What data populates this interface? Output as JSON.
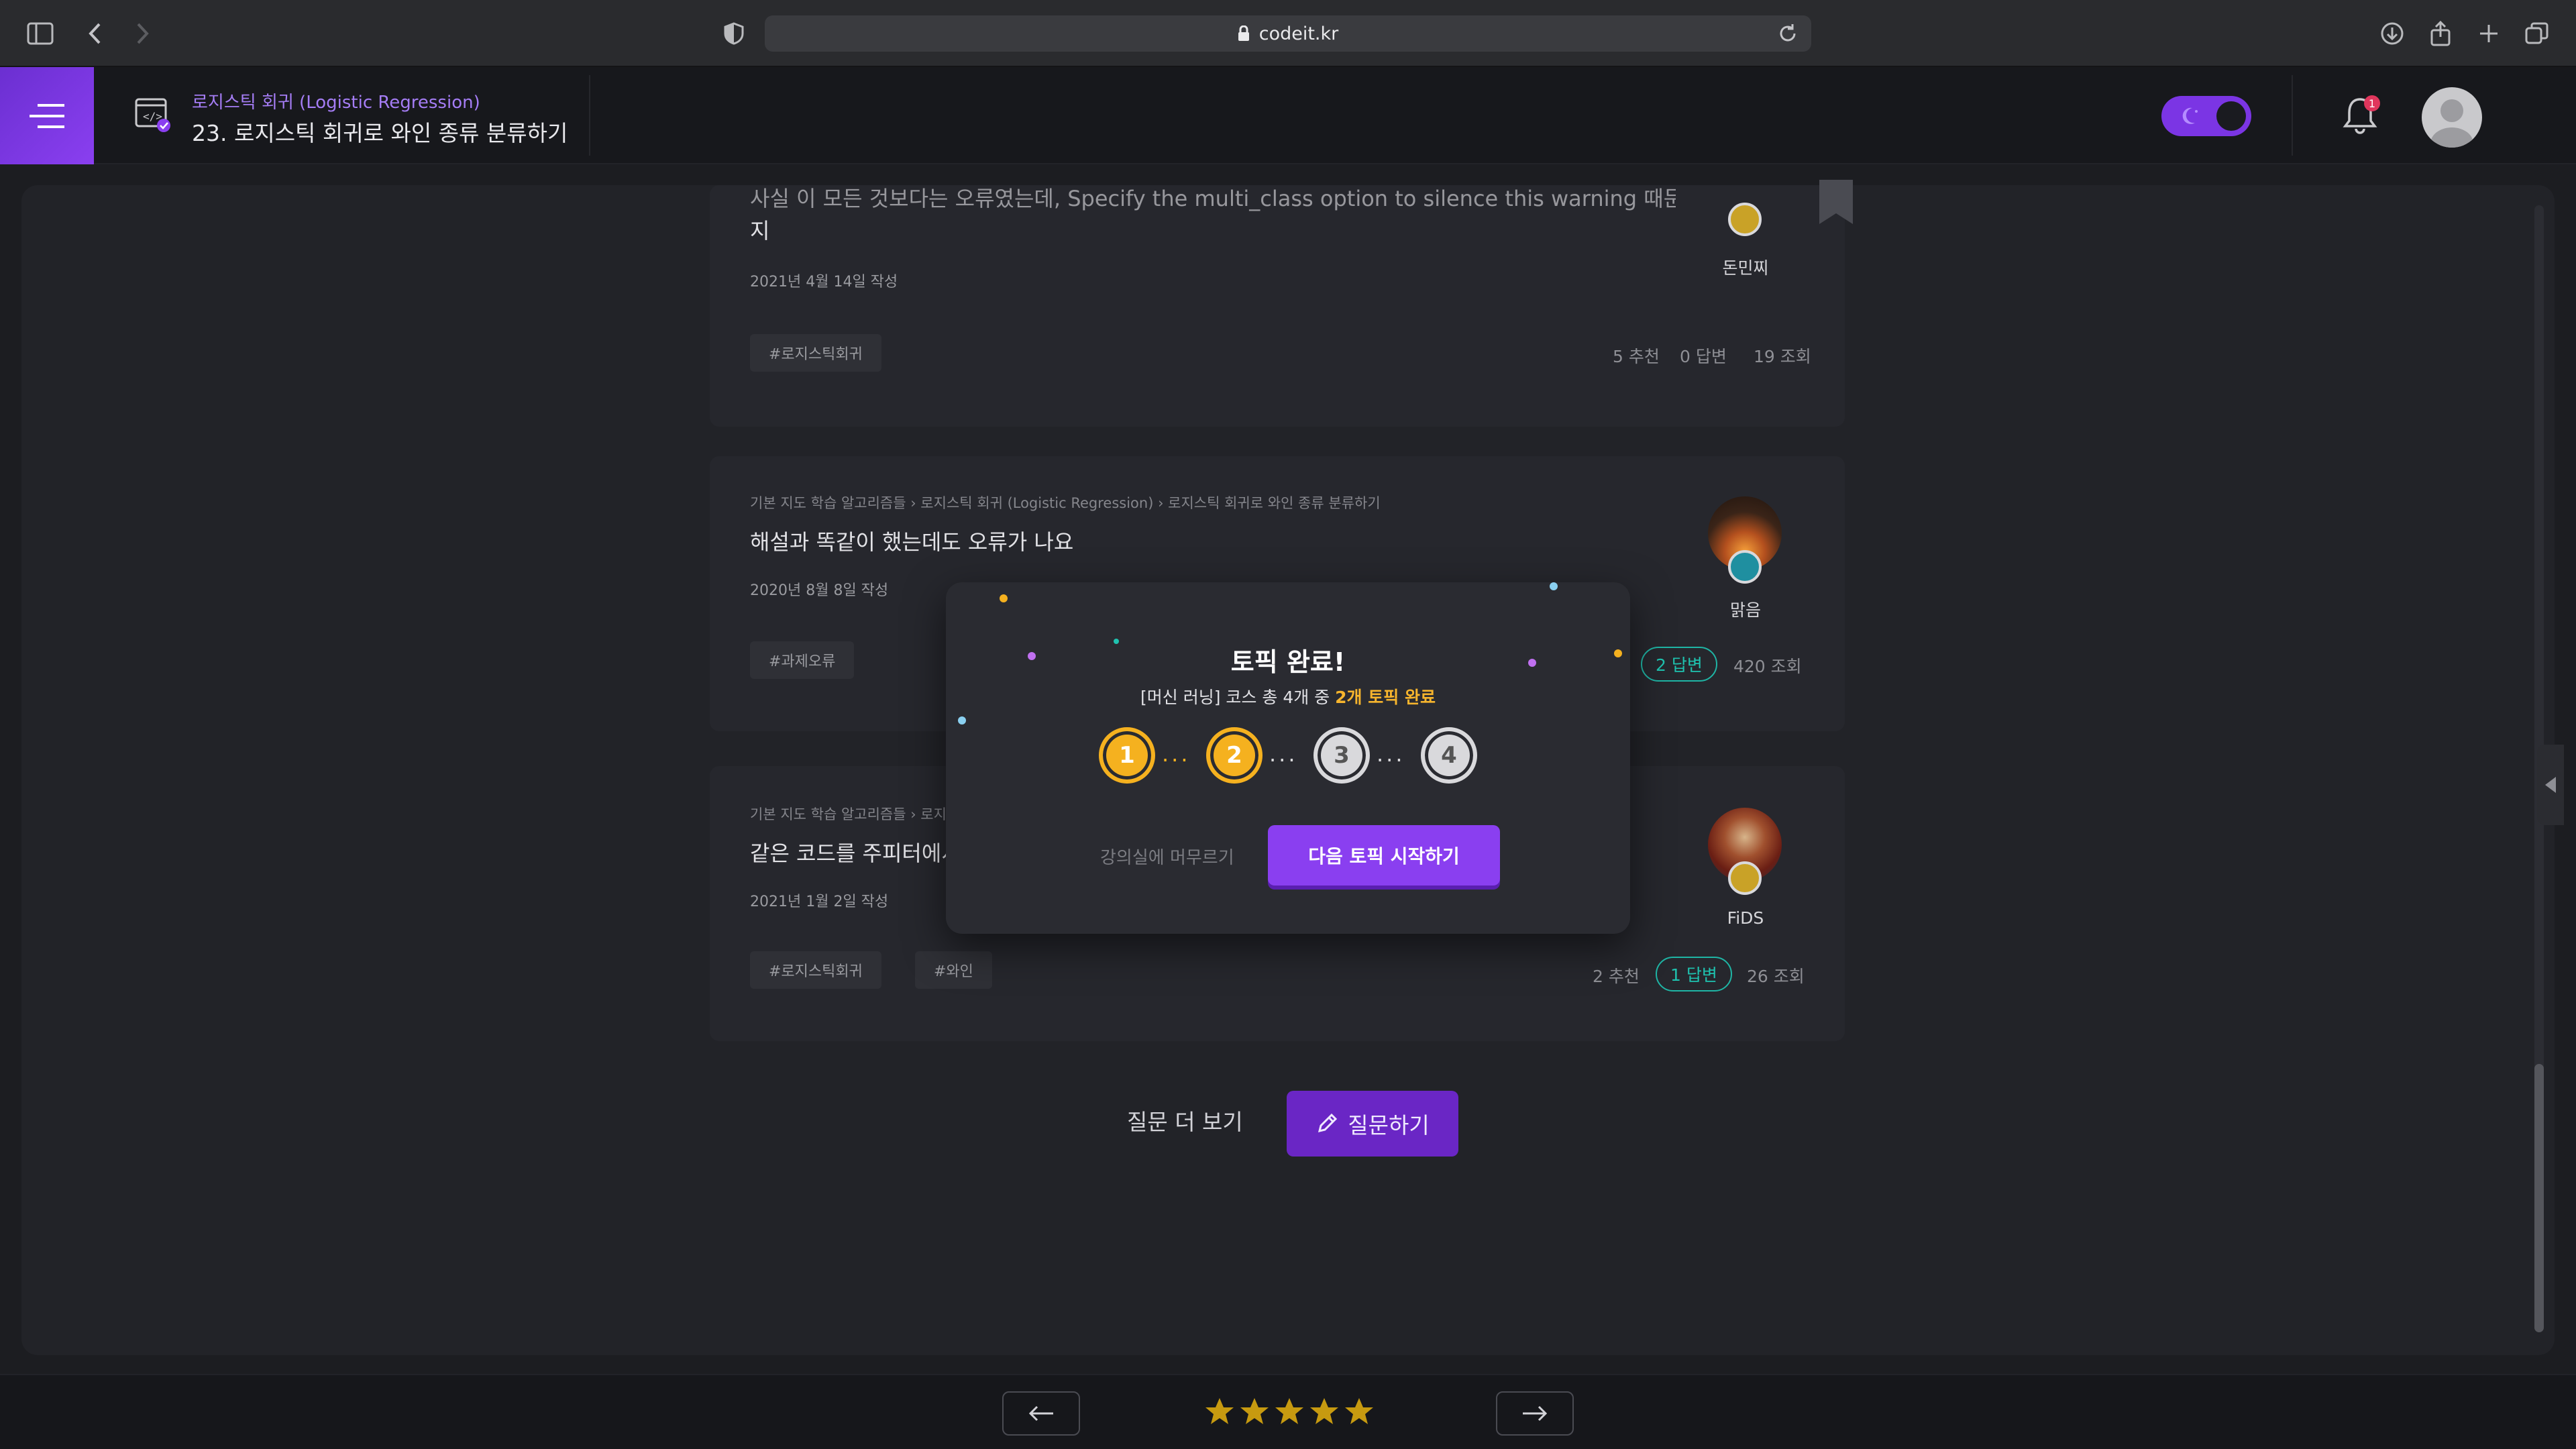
{
  "browser": {
    "url": "codeit.kr"
  },
  "header": {
    "chapter": "로지스틱 회귀 (Logistic Regression)",
    "lesson_title": "23. 로지스틱 회귀로 와인 종류 분류하기",
    "notification_count": "1"
  },
  "questions": [
    {
      "text_line1": "사실 이 모든 것보다는 오류였는데, Specify the multi_class option to silence this warning 때문에 새",
      "text_line2": "지",
      "date": "2021년 4월 14일 작성",
      "tags": [
        "#로지스틱회귀"
      ],
      "likes": "5 추천",
      "answers": "0 답변",
      "views": "19 조회",
      "author": "돈민찌"
    },
    {
      "path": "기본 지도 학습 알고리즘들 › 로지스틱 회귀 (Logistic Regression) › 로지스틱 회귀로 와인 종류 분류하기",
      "text": "해설과 똑같이 했는데도 오류가 나요",
      "date": "2020년 8월 8일 작성",
      "tags": [
        "#과제오류"
      ],
      "answers": "2 답변",
      "views": "420 조회",
      "author": "맑음"
    },
    {
      "path": "기본 지도 학습 알고리즘들 › 로지스틱 회귀",
      "text": "같은 코드를 주피터에서",
      "date": "2021년 1월 2일 작성",
      "tags": [
        "#로지스틱회귀",
        "#와인"
      ],
      "likes": "2 추천",
      "answers": "1 답변",
      "views": "26 조회",
      "author": "FiDS"
    }
  ],
  "actions": {
    "more_questions": "질문 더 보기",
    "ask": "질문하기"
  },
  "modal": {
    "title": "토픽 완료!",
    "subtitle_prefix": "[머신 러닝] 코스 총 4개 중 ",
    "subtitle_highlight": "2개 토픽 완료",
    "steps": [
      "1",
      "2",
      "3",
      "4"
    ],
    "completed_steps": 2,
    "stay_label": "강의실에 머무르기",
    "next_label": "다음 토픽 시작하기"
  },
  "footer": {
    "rating": 5
  },
  "colors": {
    "accent": "#8a3ff0",
    "gold": "#f5b11f",
    "teal": "#1fc3b0"
  }
}
